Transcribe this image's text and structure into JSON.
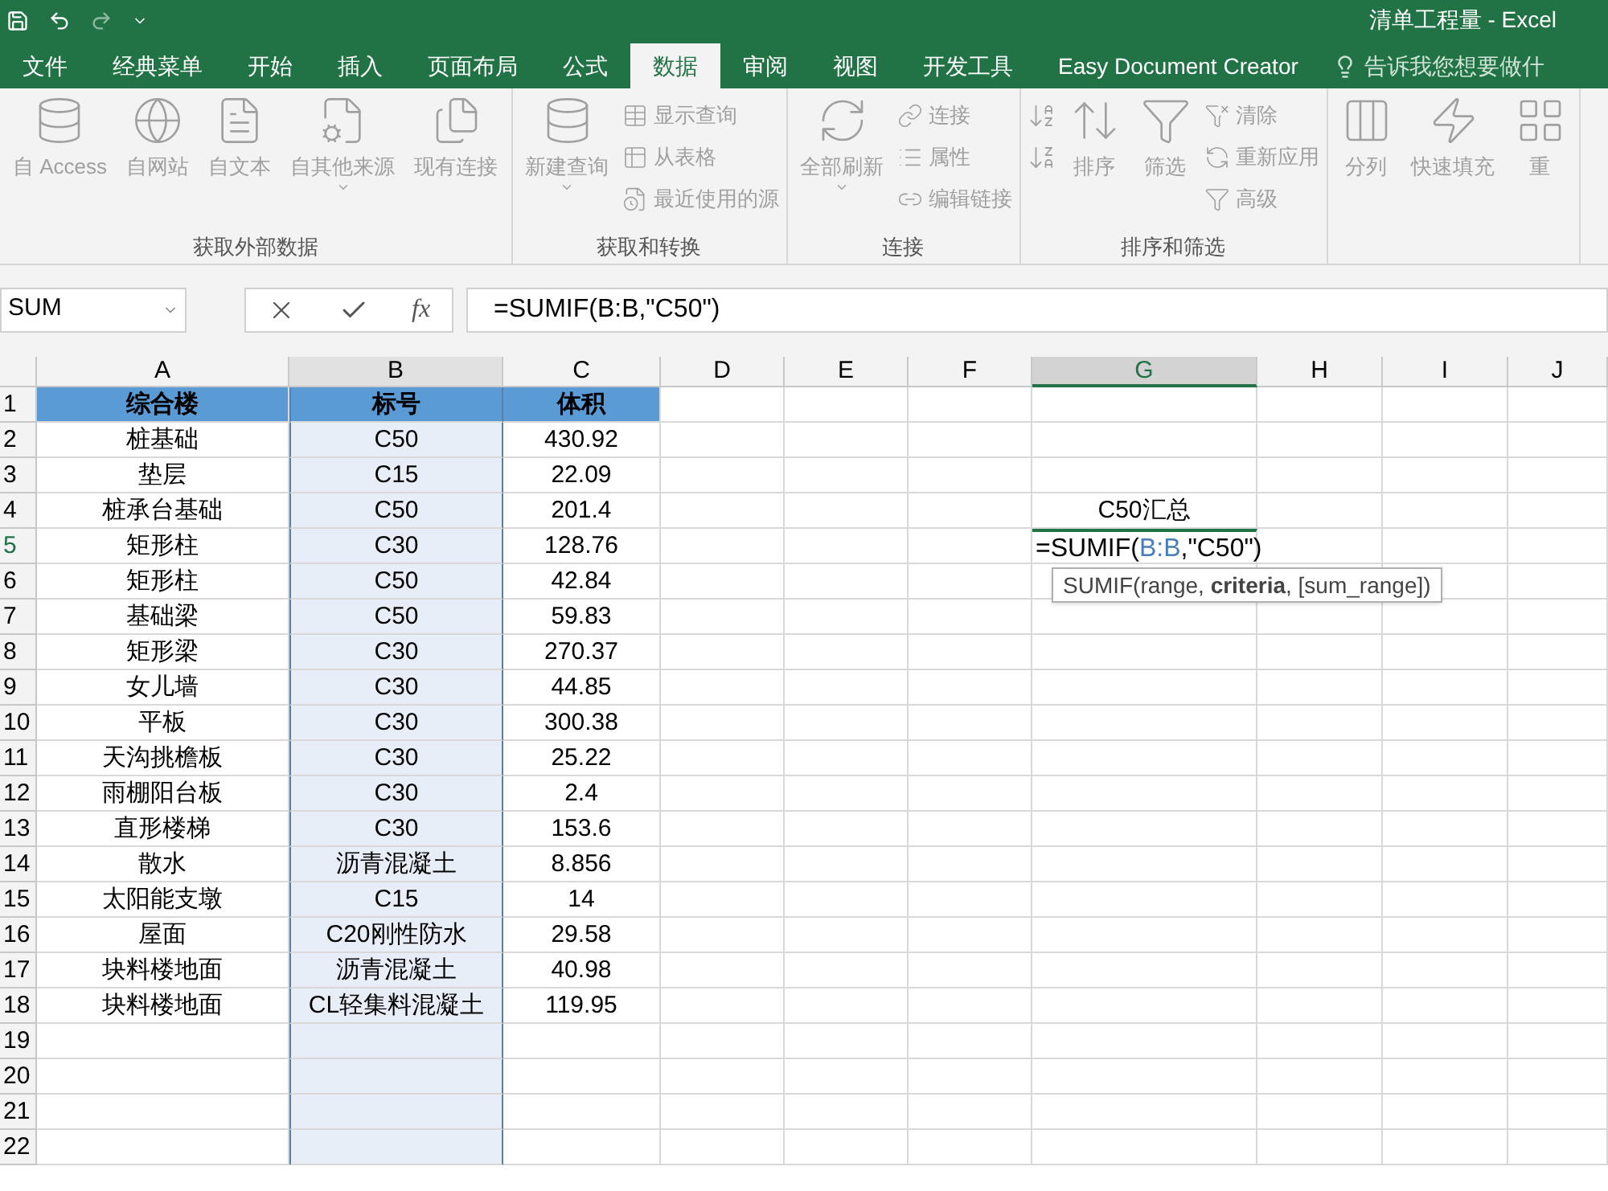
{
  "window": {
    "title": "清单工程量 - Excel"
  },
  "tabs": [
    {
      "label": "文件",
      "selected": false
    },
    {
      "label": "经典菜单",
      "selected": false
    },
    {
      "label": "开始",
      "selected": false
    },
    {
      "label": "插入",
      "selected": false
    },
    {
      "label": "页面布局",
      "selected": false
    },
    {
      "label": "公式",
      "selected": false
    },
    {
      "label": "数据",
      "selected": true
    },
    {
      "label": "审阅",
      "selected": false
    },
    {
      "label": "视图",
      "selected": false
    },
    {
      "label": "开发工具",
      "selected": false
    },
    {
      "label": "Easy Document Creator",
      "selected": false
    }
  ],
  "tell_me": {
    "placeholder": "告诉我您想要做什"
  },
  "ribbon": {
    "disabled": true,
    "groups": [
      {
        "label": "获取外部数据",
        "items": [
          {
            "kind": "large",
            "label": "自 Access"
          },
          {
            "kind": "large",
            "label": "自网站"
          },
          {
            "kind": "large",
            "label": "自文本"
          },
          {
            "kind": "large",
            "label": "自其他来源",
            "dropdown": true
          },
          {
            "kind": "large",
            "label": "现有连接"
          }
        ]
      },
      {
        "label": "获取和转换",
        "items": [
          {
            "kind": "large",
            "label": "新建查询",
            "dropdown": true
          },
          {
            "kind": "small",
            "label": "显示查询"
          },
          {
            "kind": "small",
            "label": "从表格"
          },
          {
            "kind": "small",
            "label": "最近使用的源"
          }
        ]
      },
      {
        "label": "连接",
        "items": [
          {
            "kind": "large",
            "label": "全部刷新",
            "dropdown": true
          },
          {
            "kind": "small",
            "label": "连接"
          },
          {
            "kind": "small",
            "label": "属性"
          },
          {
            "kind": "small",
            "label": "编辑链接"
          }
        ]
      },
      {
        "label": "排序和筛选",
        "items": [
          {
            "kind": "icon"
          },
          {
            "kind": "icon"
          },
          {
            "kind": "large",
            "label": "排序"
          },
          {
            "kind": "large",
            "label": "筛选"
          },
          {
            "kind": "small",
            "label": "清除"
          },
          {
            "kind": "small",
            "label": "重新应用"
          },
          {
            "kind": "small",
            "label": "高级"
          }
        ]
      },
      {
        "items": [
          {
            "kind": "large",
            "label": "分列"
          },
          {
            "kind": "large",
            "label": "快速填充"
          },
          {
            "kind": "large",
            "label": "重"
          }
        ]
      }
    ]
  },
  "formula_bar": {
    "name_box": "SUM",
    "function_button": "fx",
    "formula": "=SUMIF(B:B,\"C50\")"
  },
  "columns": [
    {
      "label": "A",
      "selected": false,
      "in_range": false
    },
    {
      "label": "B",
      "selected": false,
      "in_range": true
    },
    {
      "label": "C",
      "selected": false,
      "in_range": false
    },
    {
      "label": "D",
      "selected": false,
      "in_range": false
    },
    {
      "label": "E",
      "selected": false,
      "in_range": false
    },
    {
      "label": "F",
      "selected": false,
      "in_range": false
    },
    {
      "label": "G",
      "selected": true,
      "in_range": false
    },
    {
      "label": "H",
      "selected": false,
      "in_range": false
    },
    {
      "label": "I",
      "selected": false,
      "in_range": false
    },
    {
      "label": "J",
      "selected": false,
      "in_range": false
    }
  ],
  "rows": [
    {
      "number": "1",
      "selected": false,
      "kind": "header",
      "cells": [
        "综合楼",
        "标号",
        "体积"
      ]
    },
    {
      "number": "2",
      "selected": false,
      "kind": "data",
      "cells": [
        "桩基础",
        "C50",
        "430.92"
      ]
    },
    {
      "number": "3",
      "selected": false,
      "kind": "data",
      "cells": [
        "垫层",
        "C15",
        "22.09"
      ]
    },
    {
      "number": "4",
      "selected": false,
      "kind": "data",
      "cells": [
        "桩承台基础",
        "C50",
        "201.4"
      ],
      "g": "C50汇总"
    },
    {
      "number": "5",
      "selected": true,
      "kind": "data",
      "cells": [
        "矩形柱",
        "C30",
        "128.76"
      ],
      "editing": {
        "prefix": "=SUMIF(",
        "reference": "B:B",
        "suffix": ",\"C50\")",
        "tooltip": "SUMIF(range, **criteria**, [sum_range])"
      }
    },
    {
      "number": "6",
      "selected": false,
      "kind": "data",
      "cells": [
        "矩形柱",
        "C50",
        "42.84"
      ]
    },
    {
      "number": "7",
      "selected": false,
      "kind": "data",
      "cells": [
        "基础梁",
        "C50",
        "59.83"
      ]
    },
    {
      "number": "8",
      "selected": false,
      "kind": "data",
      "cells": [
        "矩形梁",
        "C30",
        "270.37"
      ]
    },
    {
      "number": "9",
      "selected": false,
      "kind": "data",
      "cells": [
        "女儿墙",
        "C30",
        "44.85"
      ]
    },
    {
      "number": "10",
      "selected": false,
      "kind": "data",
      "cells": [
        "平板",
        "C30",
        "300.38"
      ]
    },
    {
      "number": "11",
      "selected": false,
      "kind": "data",
      "cells": [
        "天沟挑檐板",
        "C30",
        "25.22"
      ]
    },
    {
      "number": "12",
      "selected": false,
      "kind": "data",
      "cells": [
        "雨棚阳台板",
        "C30",
        "2.4"
      ]
    },
    {
      "number": "13",
      "selected": false,
      "kind": "data",
      "cells": [
        "直形楼梯",
        "C30",
        "153.6"
      ]
    },
    {
      "number": "14",
      "selected": false,
      "kind": "data",
      "cells": [
        "散水",
        "沥青混凝土",
        "8.856"
      ]
    },
    {
      "number": "15",
      "selected": false,
      "kind": "data",
      "cells": [
        "太阳能支墩",
        "C15",
        "14"
      ]
    },
    {
      "number": "16",
      "selected": false,
      "kind": "data",
      "cells": [
        "屋面",
        "C20刚性防水",
        "29.58"
      ]
    },
    {
      "number": "17",
      "selected": false,
      "kind": "data",
      "cells": [
        "块料楼地面",
        "沥青混凝土",
        "40.98"
      ]
    },
    {
      "number": "18",
      "selected": false,
      "kind": "data",
      "cells": [
        "块料楼地面",
        "CL轻集料混凝土",
        "119.95"
      ]
    },
    {
      "number": "19",
      "selected": false,
      "kind": "empty"
    },
    {
      "number": "20",
      "selected": false,
      "kind": "empty"
    },
    {
      "number": "21",
      "selected": false,
      "kind": "empty"
    },
    {
      "number": "22",
      "selected": false,
      "kind": "empty"
    }
  ]
}
